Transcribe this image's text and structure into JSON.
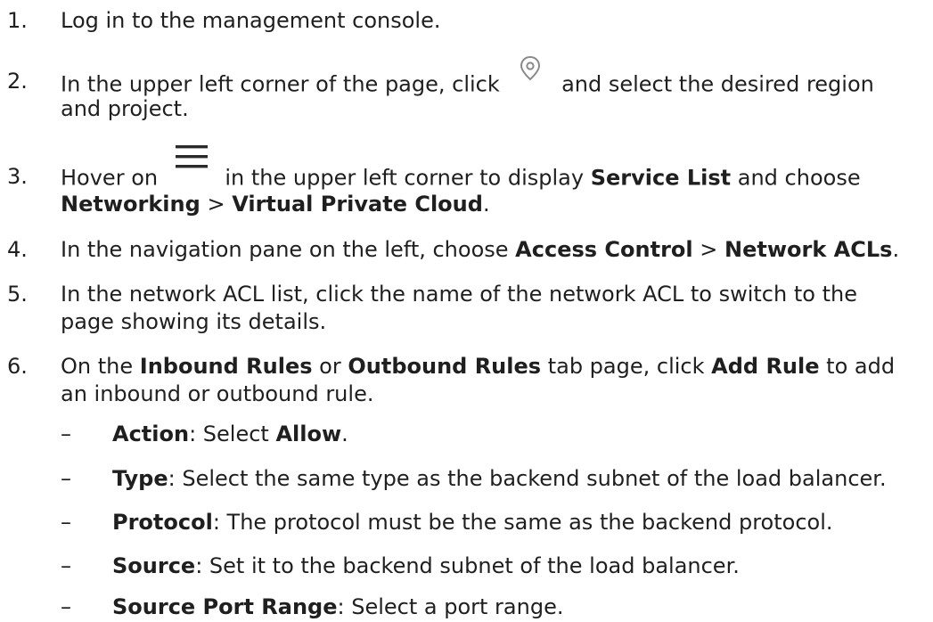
{
  "steps": [
    {
      "num": "1.",
      "text": "Log in to the management console."
    },
    {
      "num": "2.",
      "l1a": "In the upper left corner of the page, click",
      "icon": "location-pin-icon",
      "l1b": "and select the desired region",
      "l2": "and project."
    },
    {
      "num": "3.",
      "l1a": "Hover on",
      "icon": "hamburger-menu-icon",
      "l1b": "in the upper left corner to display",
      "l1c": "Service List",
      "l1d": "and choose",
      "l2a": "Networking",
      "l2b": ">",
      "l2c": "Virtual Private Cloud",
      "l2d": "."
    },
    {
      "num": "4.",
      "a": "In the navigation pane on the left, choose",
      "b": "Access Control",
      "c": ">",
      "d": "Network ACLs",
      "e": "."
    },
    {
      "num": "5.",
      "l1": "In the network ACL list, click the name of the network ACL to switch to the",
      "l2": "page showing its details."
    },
    {
      "num": "6.",
      "l1a": "On the",
      "l1b": "Inbound Rules",
      "l1c": "or",
      "l1d": "Outbound Rules",
      "l1e": "tab page, click",
      "l1f": "Add Rule",
      "l1g": "to add",
      "l2": "an inbound or outbound rule."
    }
  ],
  "subitems": [
    {
      "dash": "–",
      "label": "Action",
      "text": ": Select ",
      "bold2": "Allow",
      "end": "."
    },
    {
      "dash": "–",
      "label": "Type",
      "text": ": Select the same type as the backend subnet of the load balancer."
    },
    {
      "dash": "–",
      "label": "Protocol",
      "text": ": The protocol must be the same as the backend protocol."
    },
    {
      "dash": "–",
      "label": "Source",
      "text": ": Set it to the backend subnet of the load balancer."
    },
    {
      "dash": "–",
      "label": "Source Port Range",
      "text": ": Select a port range."
    }
  ]
}
